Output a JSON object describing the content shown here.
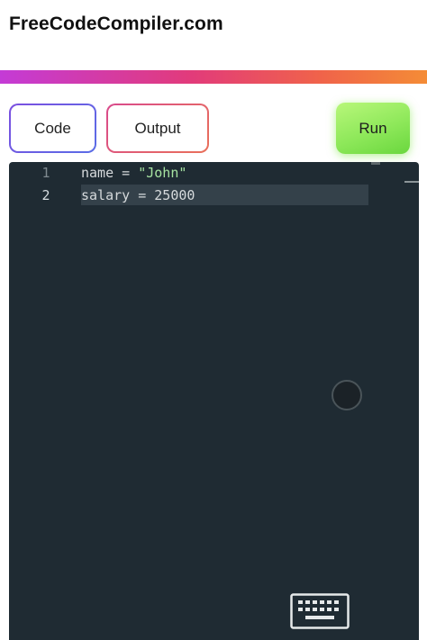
{
  "header": {
    "site_title": "FreeCodeCompiler.com"
  },
  "toolbar": {
    "code_label": "Code",
    "output_label": "Output",
    "run_label": "Run"
  },
  "editor": {
    "lines": [
      {
        "number": "1",
        "tokens": {
          "pre": "name = ",
          "string": "\"John\""
        }
      },
      {
        "number": "2",
        "text": "salary = 25000",
        "active": true
      }
    ]
  },
  "icons": {
    "keyboard": "keyboard-icon",
    "floating": "floating-action-icon"
  },
  "colors": {
    "editor_bg": "#1f2b33",
    "string": "#a6e3a1",
    "run_button": "#8ee85a",
    "gradient_start": "#c43bd6",
    "gradient_end": "#f48c36"
  }
}
